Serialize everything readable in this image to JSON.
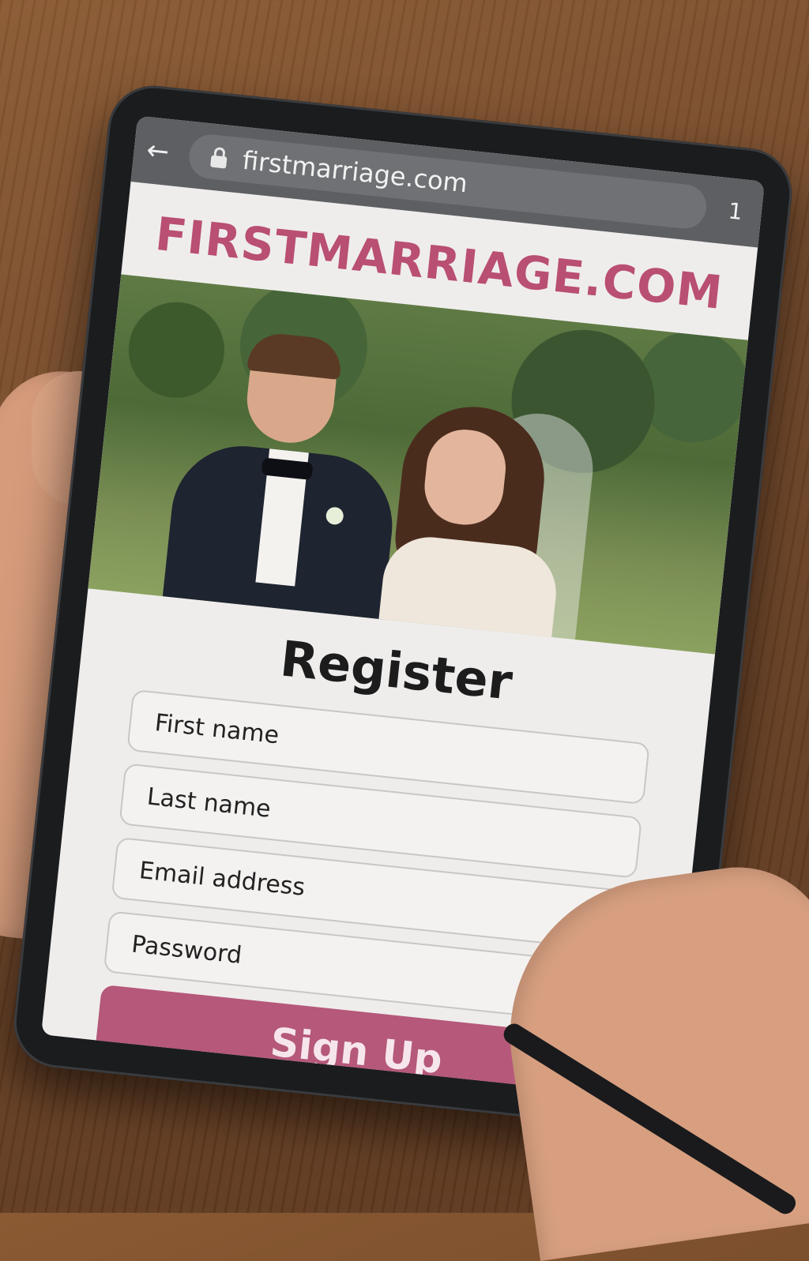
{
  "browser": {
    "url": "firstmarriage.com",
    "tab_count": "1"
  },
  "site": {
    "title": "FIRSTMARRIAGE.COM"
  },
  "form": {
    "heading": "Register",
    "fields": [
      {
        "placeholder": "First name"
      },
      {
        "placeholder": "Last name"
      },
      {
        "placeholder": "Email address"
      },
      {
        "placeholder": "Password"
      }
    ],
    "submit_label": "Sign Up"
  },
  "colors": {
    "brand": "#b94f72",
    "button": "#b5587a",
    "browser_bar": "#5d5f62"
  },
  "icons": {
    "back": "back-arrow-icon",
    "lock": "lock-icon"
  }
}
